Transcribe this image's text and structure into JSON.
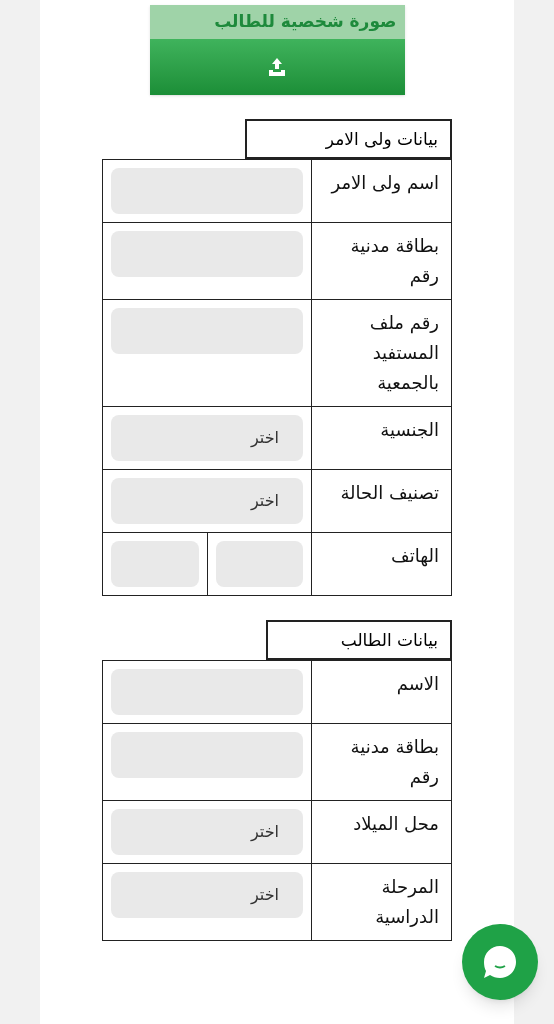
{
  "upload": {
    "title": "صورة شخصية للطالب"
  },
  "sections": [
    {
      "title": "بيانات ولى الامر",
      "rows": [
        {
          "kind": "text",
          "label": "اسم ولى الامر"
        },
        {
          "kind": "text",
          "label": "بطاقة مدنية رقم"
        },
        {
          "kind": "text",
          "label": "رقم ملف المستفيد بالجمعية"
        },
        {
          "kind": "select",
          "label": "الجنسية",
          "placeholder": "اختر"
        },
        {
          "kind": "select",
          "label": "تصنيف الحالة",
          "placeholder": "اختر"
        },
        {
          "kind": "phone",
          "label": "الهاتف"
        }
      ]
    },
    {
      "title": "بيانات الطالب",
      "rows": [
        {
          "kind": "text",
          "label": "الاسم"
        },
        {
          "kind": "text",
          "label": "بطاقة مدنية رقم"
        },
        {
          "kind": "select",
          "label": "محل الميلاد",
          "placeholder": "اختر"
        },
        {
          "kind": "select",
          "label": "المرحلة الدراسية",
          "placeholder": "اختر"
        }
      ]
    }
  ]
}
